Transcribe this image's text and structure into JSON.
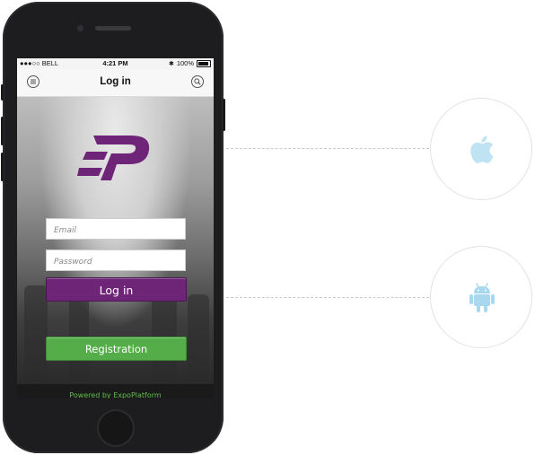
{
  "status_bar": {
    "carrier": "●●●○○ BELL",
    "time": "4:21 PM",
    "battery": "100%"
  },
  "nav": {
    "title": "Log in",
    "menu_icon": "menu-icon",
    "search_icon": "search-icon"
  },
  "brand": {
    "logo": "expoplatform-logo",
    "color": "#6e2577"
  },
  "form": {
    "email_placeholder": "Email",
    "password_placeholder": "Password",
    "login_label": "Log in",
    "registration_label": "Registration"
  },
  "footer": {
    "powered_by": "Powered by ExpoPlatform"
  },
  "platforms": [
    {
      "icon": "apple-icon",
      "color": "#bfe3f3"
    },
    {
      "icon": "android-icon",
      "color": "#a9d8ee"
    }
  ],
  "colors": {
    "login_button": "#6e2577",
    "registration_button": "#55ad49",
    "link": "#5fbf4a"
  }
}
